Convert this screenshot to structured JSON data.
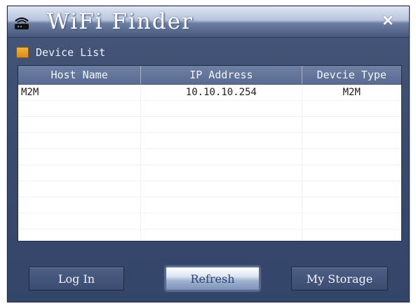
{
  "window": {
    "title": "WiFi Finder",
    "close_label": "×"
  },
  "section": {
    "label": "Device List"
  },
  "table": {
    "columns": [
      "Host Name",
      "IP Address",
      "Devcie Type"
    ],
    "rows": [
      [
        "M2M",
        "10.10.10.254",
        "M2M"
      ]
    ]
  },
  "buttons": {
    "login": "Log In",
    "refresh": "Refresh",
    "storage": "My Storage"
  },
  "colors": {
    "window_bg": "#3a4b6e",
    "header_bg": "#5a6b91",
    "accent_folder": "#f0b43c"
  },
  "icons": {
    "app": "router-icon",
    "section": "folder-icon",
    "close": "close-icon"
  }
}
